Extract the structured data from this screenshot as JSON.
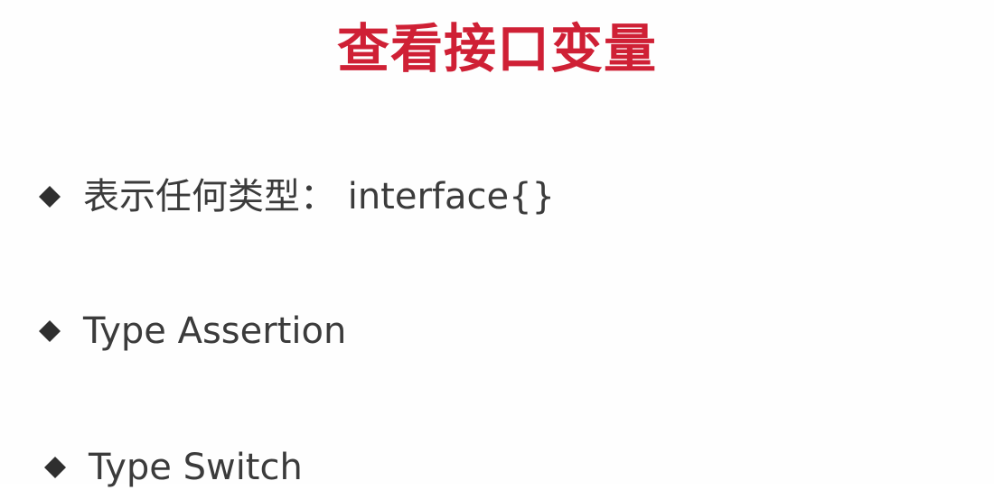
{
  "slide": {
    "title": "查看接口变量",
    "bullets": [
      {
        "icon": "diamond-bullet-icon",
        "text": "表示任何类型： interface{}"
      },
      {
        "icon": "diamond-bullet-icon",
        "text": "Type Assertion"
      },
      {
        "icon": "diamond-bullet-icon",
        "text": "Type Switch"
      }
    ]
  },
  "colors": {
    "title": "#cf2035",
    "text": "#3b3b3b",
    "background": "#fefefe"
  }
}
